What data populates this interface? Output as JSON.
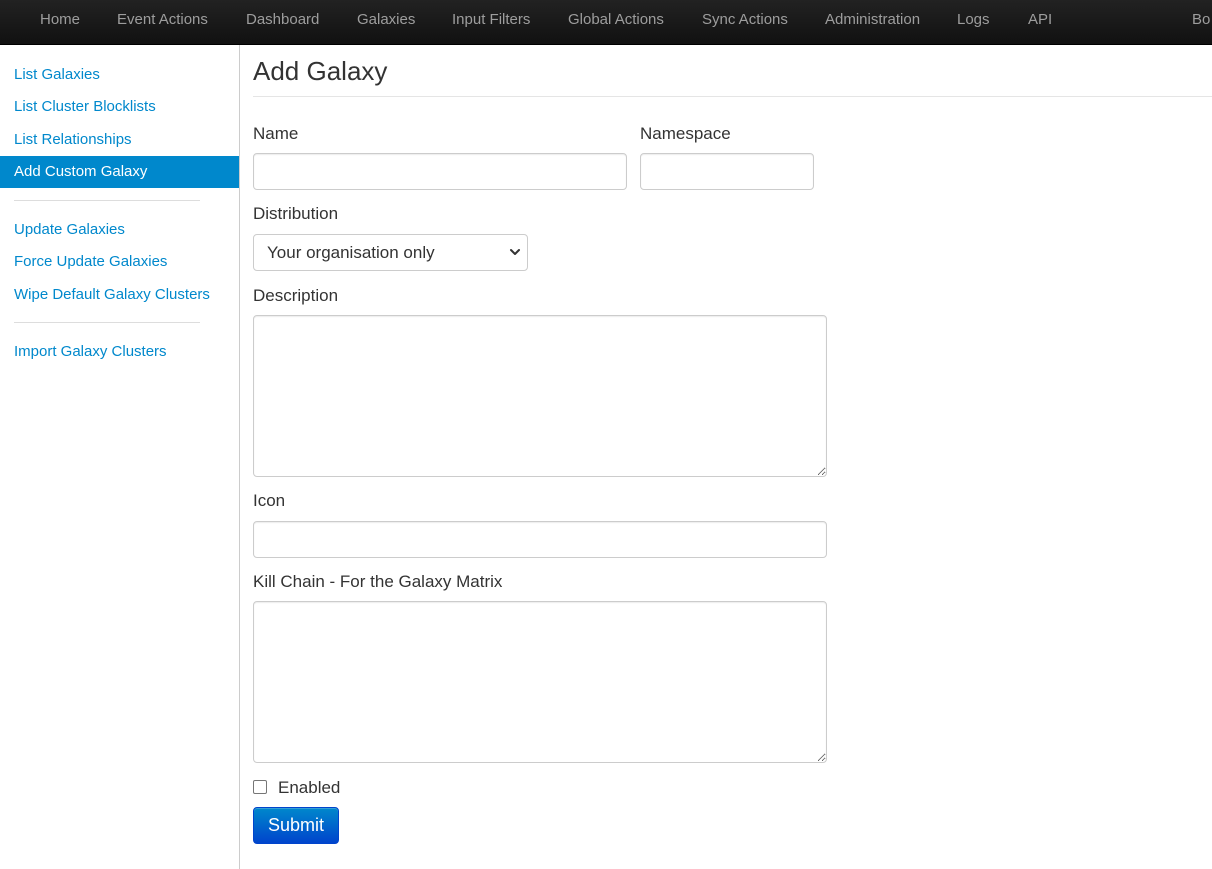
{
  "navbar": {
    "items": [
      "Home",
      "Event Actions",
      "Dashboard",
      "Galaxies",
      "Input Filters",
      "Global Actions",
      "Sync Actions",
      "Administration",
      "Logs",
      "API",
      "Bo"
    ]
  },
  "sidebar": {
    "group1": [
      "List Galaxies",
      "List Cluster Blocklists",
      "List Relationships",
      "Add Custom Galaxy"
    ],
    "active": "Add Custom Galaxy",
    "group2": [
      "Update Galaxies",
      "Force Update Galaxies",
      "Wipe Default Galaxy Clusters"
    ],
    "group3": [
      "Import Galaxy Clusters"
    ]
  },
  "form": {
    "title": "Add Galaxy",
    "name_label": "Name",
    "name_value": "",
    "namespace_label": "Namespace",
    "namespace_value": "",
    "distribution_label": "Distribution",
    "distribution_value": "Your organisation only",
    "description_label": "Description",
    "description_value": "",
    "icon_label": "Icon",
    "icon_value": "",
    "killchain_label": "Kill Chain - For the Galaxy Matrix",
    "killchain_value": "",
    "enabled_label": "Enabled",
    "enabled_checked": false,
    "submit_label": "Submit"
  },
  "colors": {
    "navbar_bg": "#1b1b1b",
    "nav_text": "#9d9d9d",
    "link": "#0088cc",
    "active_bg": "#0088cc",
    "button_top": "#0088cc",
    "button_bottom": "#0044cc"
  },
  "icons": {
    "select_arrow": "chevron-down-icon",
    "checkbox": "checkbox-icon"
  }
}
